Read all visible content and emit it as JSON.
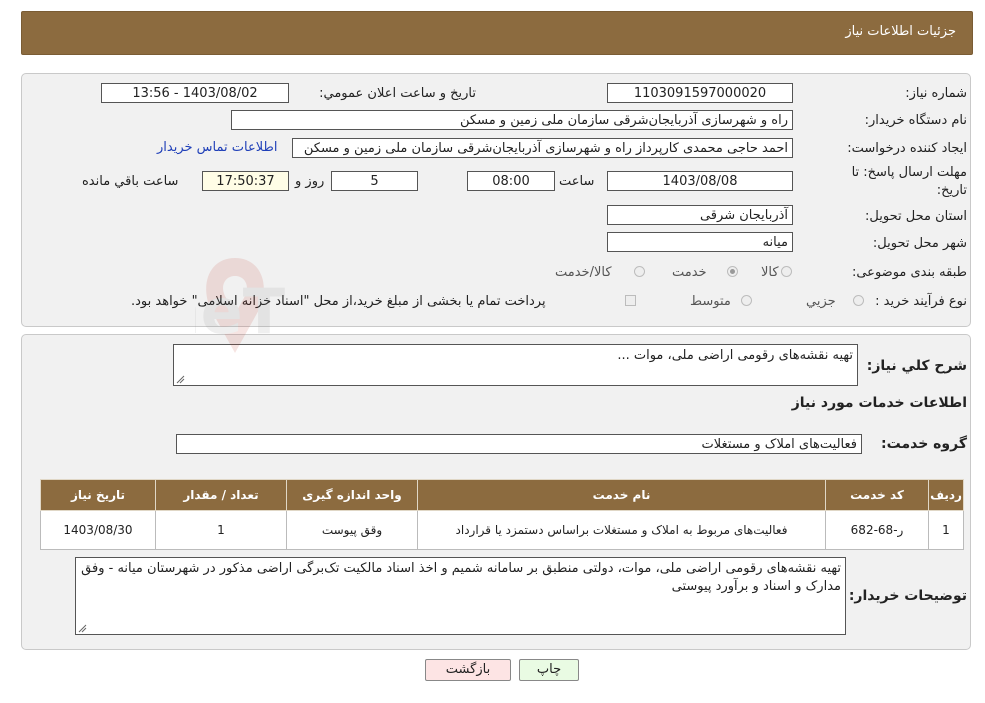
{
  "header": {
    "title": "جزئیات اطلاعات نیاز"
  },
  "form": {
    "need_number": {
      "label": "شماره نیاز:",
      "value": "1103091597000020"
    },
    "announce": {
      "label": "تاریخ و ساعت اعلان عمومي:",
      "value": "1403/08/02 - 13:56"
    },
    "buyer_org": {
      "label": "نام دستگاه خريدار:",
      "value": "راه و شهرسازی آذربایجان‌شرقی   سازمان ملی زمین و مسکن"
    },
    "creator": {
      "label": "ايجاد کننده درخواست:",
      "value": "احمد حاجی محمدی کارپرداز راه و شهرسازی آذربایجان‌شرقی   سازمان ملی زمین و مسکن",
      "contact_link": "اطلاعات تماس خريدار"
    },
    "deadline": {
      "label_line1": "مهلت ارسال پاسخ: تا",
      "label_line2": "تاریخ:",
      "date": "1403/08/08",
      "time_label": "ساعت",
      "time": "08:00",
      "days": "5",
      "days_label": "روز و",
      "remaining": "17:50:37",
      "remaining_label": "ساعت باقي مانده"
    },
    "province": {
      "label": "استان محل تحويل:",
      "value": "آذربایجان شرقی"
    },
    "city": {
      "label": "شهر محل تحويل:",
      "value": "میانه"
    },
    "category": {
      "label": "طبقه بندی موضوعی:",
      "options": [
        {
          "label": "کالا",
          "selected": false
        },
        {
          "label": "خدمت",
          "selected": true
        },
        {
          "label": "کالا/خدمت",
          "selected": false
        }
      ]
    },
    "process": {
      "label": "نوع فرآيند خريد :",
      "options": [
        {
          "label": "جزيي",
          "selected": false
        },
        {
          "label": "متوسط",
          "selected": false
        }
      ],
      "payment_note": "پرداخت تمام يا بخشی از مبلغ خريد،از محل \"اسناد خزانه اسلامی\" خواهد بود."
    }
  },
  "details": {
    "summary": {
      "label": "شرح کلي نياز:",
      "value": "تهیه نقشه‌های رقومی اراضی ملی، موات ..."
    },
    "services_title": "اطلاعات خدمات مورد نياز",
    "service_group": {
      "label": "گروه خدمت:",
      "value": "فعالیت‌های  املاک و مستغلات"
    },
    "table": {
      "headers": [
        "رديف",
        "کد خدمت",
        "نام خدمت",
        "واحد اندازه گيری",
        "تعداد / مقدار",
        "تاريخ نياز"
      ],
      "rows": [
        [
          "1",
          "ر-68-682",
          "فعالیت‌های مربوط به املاک و مستغلات براساس دستمزد یا قرارداد",
          "وقق پیوست",
          "1",
          "1403/08/30"
        ]
      ]
    },
    "buyer_notes": {
      "label": "توضيحات خريدار:",
      "value": "تهیه نقشه‌های رقومی اراضی ملی، موات، دولتی منطبق بر سامانه شمیم و اخذ اسناد مالکیت تک‌برگی اراضی مذکور در شهرستان میانه - وفق مدارک و اسناد و برآورد پیوستی"
    }
  },
  "buttons": {
    "print": "چاپ",
    "back": "بازگشت"
  },
  "watermark": {
    "text": "AriaTender.neT"
  }
}
